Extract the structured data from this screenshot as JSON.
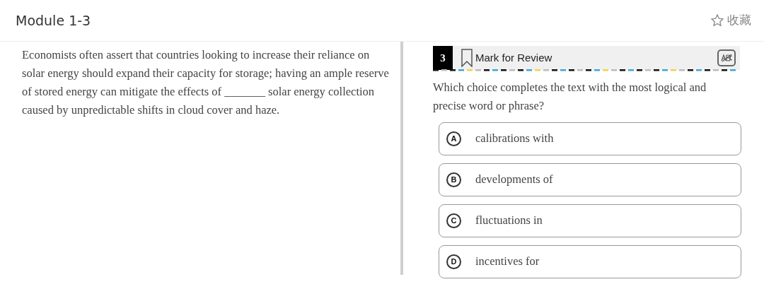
{
  "header": {
    "title": "Module 1-3",
    "favorite_label": "收藏"
  },
  "passage": {
    "text": "Economists often assert that countries looking to increase their reliance on solar energy should expand their capacity for storage; having an ample reserve of stored energy can mitigate the effects of _______ solar energy collection caused by unpredictable shifts in cloud cover and haze."
  },
  "question": {
    "number": "3",
    "mark_label": "Mark for Review",
    "prompt": "Which choice completes the text with the most logical and precise word or phrase?",
    "options": [
      {
        "letter": "A",
        "text": "calibrations with",
        "selected": false
      },
      {
        "letter": "B",
        "text": "developments of",
        "selected": false
      },
      {
        "letter": "C",
        "text": "fluctuations in",
        "selected": false
      },
      {
        "letter": "D",
        "text": "incentives for",
        "selected": false
      }
    ]
  }
}
